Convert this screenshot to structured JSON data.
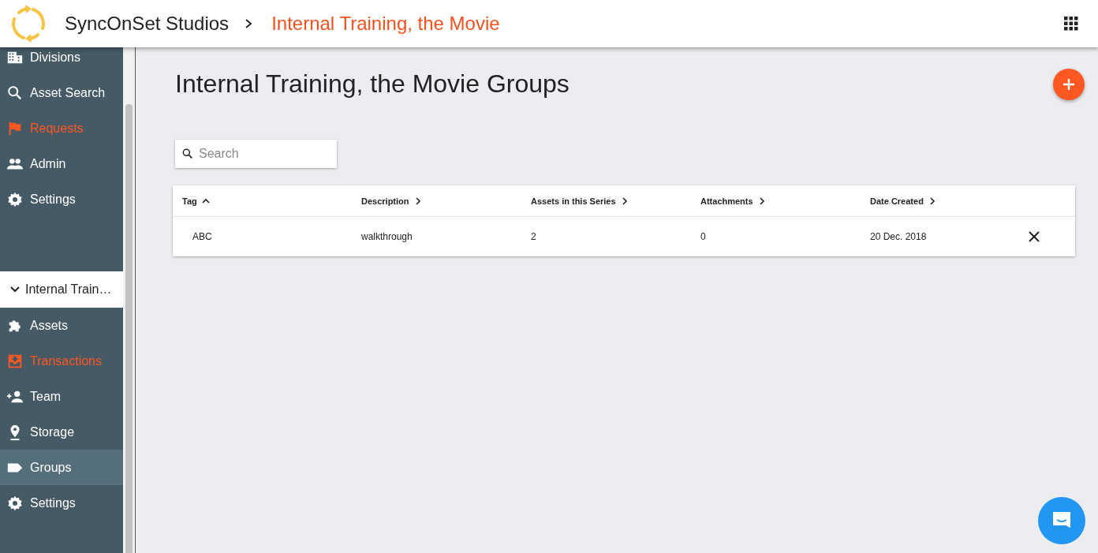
{
  "header": {
    "brand": "SyncOnSet Studios",
    "breadcrumb": "Internal Training, the Movie"
  },
  "sidebar": {
    "global_items": [
      {
        "label": "Divisions",
        "kind": "building",
        "alert": false,
        "selected": false
      },
      {
        "label": "Asset Search",
        "kind": "search",
        "alert": false,
        "selected": false
      },
      {
        "label": "Requests",
        "kind": "flag",
        "alert": true,
        "selected": false
      },
      {
        "label": "Admin",
        "kind": "people",
        "alert": false,
        "selected": false
      },
      {
        "label": "Settings",
        "kind": "gear",
        "alert": false,
        "selected": false
      }
    ],
    "project": {
      "label": "Internal Train…",
      "expanded": true
    },
    "project_items": [
      {
        "label": "Assets",
        "kind": "puzzle",
        "alert": false,
        "selected": false
      },
      {
        "label": "Transactions",
        "kind": "inbox",
        "alert": true,
        "selected": false
      },
      {
        "label": "Team",
        "kind": "addperson",
        "alert": false,
        "selected": false
      },
      {
        "label": "Storage",
        "kind": "pin",
        "alert": false,
        "selected": false
      },
      {
        "label": "Groups",
        "kind": "tag",
        "alert": false,
        "selected": true
      },
      {
        "label": "Settings",
        "kind": "gear",
        "alert": false,
        "selected": false
      }
    ]
  },
  "page": {
    "title": "Internal Training, the Movie Groups"
  },
  "search": {
    "placeholder": "Search"
  },
  "table": {
    "columns": [
      {
        "label": "Tag",
        "sorted": true
      },
      {
        "label": "Description",
        "sorted": false
      },
      {
        "label": "Assets in this Series",
        "sorted": false
      },
      {
        "label": "Attachments",
        "sorted": false
      },
      {
        "label": "Date Created",
        "sorted": false
      }
    ],
    "rows": [
      {
        "cells": [
          "ABC",
          "walkthrough",
          "2",
          "0",
          "20 Dec. 2018"
        ]
      }
    ]
  }
}
